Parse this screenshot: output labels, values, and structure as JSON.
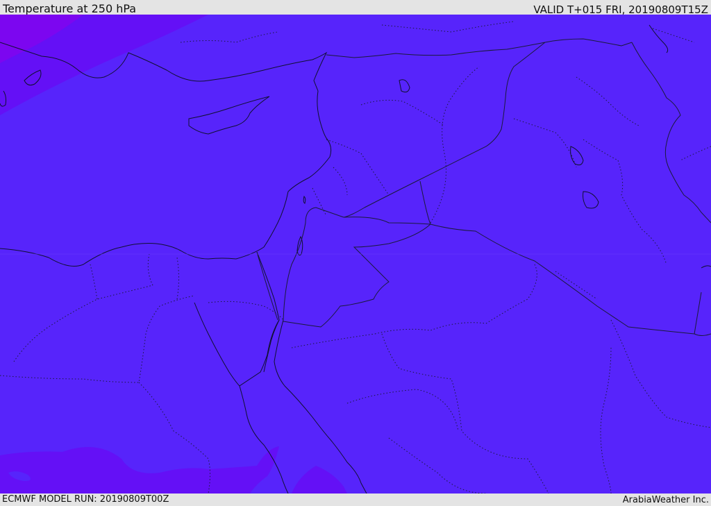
{
  "header": {
    "title": "Temperature at 250 hPa",
    "valid_time": "VALID T+015 FRI, 20190809T15Z"
  },
  "footer": {
    "model_run": "ECMWF MODEL RUN: 20190809T00Z",
    "credit": "ArabiaWeather Inc."
  },
  "map": {
    "colors": {
      "base_field": "#5724fb",
      "cold_field": "#6a10f8",
      "coldest_field": "#7c06f0",
      "coast_line": "#101030",
      "border_line": "#1a1a3a"
    }
  }
}
